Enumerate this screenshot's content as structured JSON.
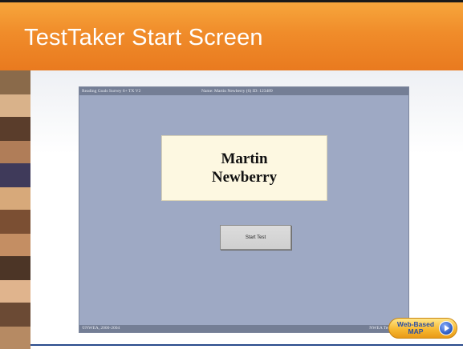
{
  "slide": {
    "title": "TestTaker Start Screen"
  },
  "app": {
    "top_left": "Reading Goals Survey 6+ TX V2",
    "top_student": "Name: Martin Newberry (6)   ID: 123489",
    "student_name_line1": "Martin",
    "student_name_line2": "Newberry",
    "start_button": "Start Test",
    "copyright": "©NWEA, 2000-2004",
    "brand": "NWEA Tests"
  },
  "badge": {
    "line1": "Web-Based",
    "line2": "MAP"
  },
  "colors": {
    "header_orange": "#f08c2a",
    "app_background": "#9ea9c4",
    "app_bar": "#747e95",
    "name_panel": "#fdf8e1",
    "badge_text": "#2b4fa3"
  }
}
